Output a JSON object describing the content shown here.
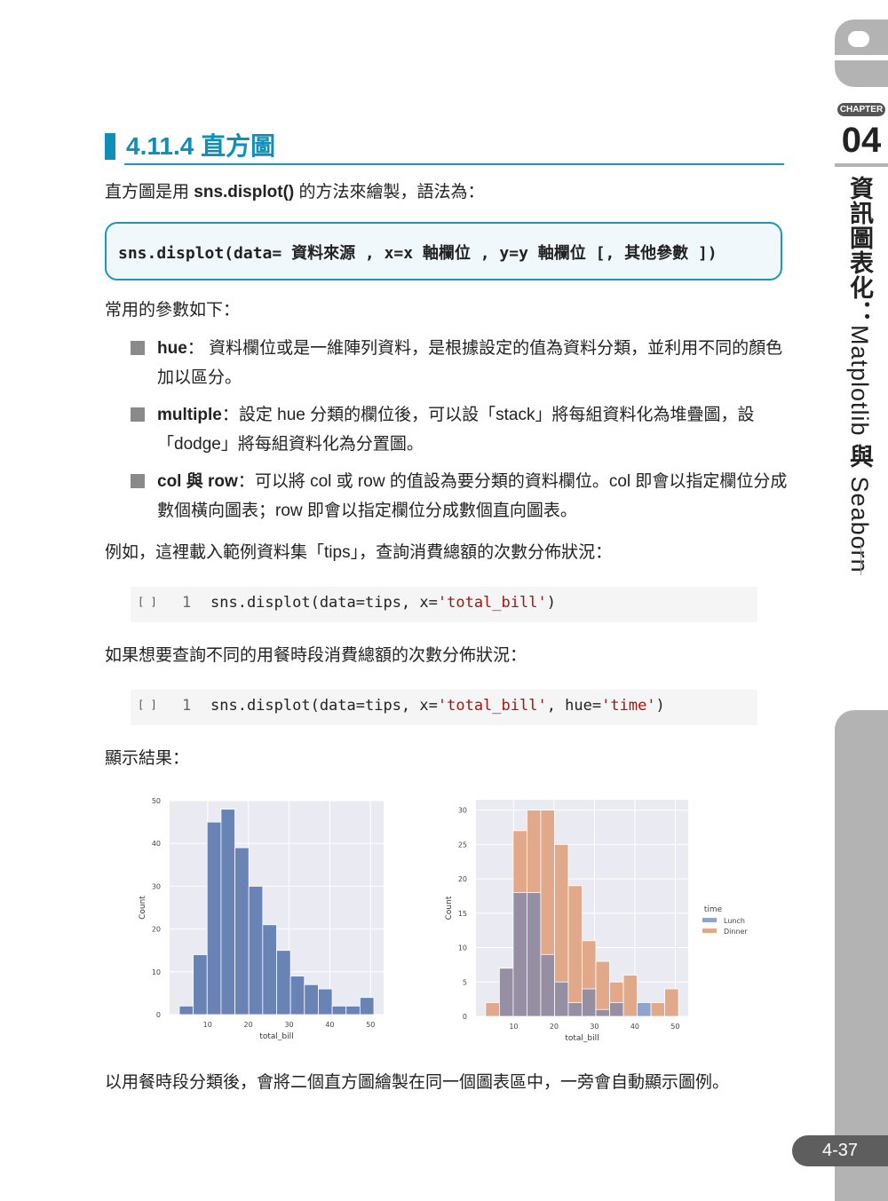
{
  "sidebar": {
    "chapter_badge": "CHAPTER",
    "chapter_number": "04",
    "chapter_title_cjk1": "資訊圖表化：",
    "chapter_title_latin1": "Matplotlib",
    "chapter_title_cjk2": " 與 ",
    "chapter_title_latin2": "Seaborn",
    "page_number": "4-37"
  },
  "section": {
    "title": "4.11.4  直方圖"
  },
  "intro": {
    "prefix": "直方圖是用 ",
    "method": "sns.displot()",
    "suffix": " 的方法來繪製，語法為："
  },
  "syntax": "sns.displot(data= 資料來源 , x=x 軸欄位 , y=y 軸欄位 [, 其他參數 ])",
  "params_intro": "常用的參數如下：",
  "params": [
    {
      "name": "hue",
      "sep": "： ",
      "desc": "資料欄位或是一維陣列資料，是根據設定的值為資料分類，並利用不同的顏色加以區分。"
    },
    {
      "name": "multiple",
      "sep": "：",
      "desc": "設定 hue 分類的欄位後，可以設「stack」將每組資料化為堆疊圖，設「dodge」將每組資料化為分置圖。"
    },
    {
      "name": "col 與 row",
      "sep": "：",
      "desc": "可以將 col 或 row 的值設為要分類的資料欄位。col 即會以指定欄位分成數個橫向圖表；row 即會以指定欄位分成數個直向圖表。"
    }
  ],
  "example1_text": "例如，這裡載入範例資料集「tips」，查詢消費總額的次數分佈狀況：",
  "code1": {
    "bracket": "[ ]",
    "line": "1",
    "pre": "sns.displot(data=tips, x=",
    "str1": "'total_bill'",
    "post": ")"
  },
  "example2_text": "如果想要查詢不同的用餐時段消費總額的次數分佈狀況：",
  "code2": {
    "bracket": "[ ]",
    "line": "1",
    "pre": "sns.displot(data=tips, x=",
    "str1": "'total_bill'",
    "mid": ", hue=",
    "str2": "'time'",
    "post": ")"
  },
  "result_label": "顯示結果：",
  "conclusion": "以用餐時段分類後，會將二個直方圖繪製在同一個圖表區中，一旁會自動顯示圖例。",
  "colors": {
    "accent": "#0f8fb8",
    "hist_blue": "#6a83b5",
    "lunch": "#8fa4cc",
    "dinner": "#e2a88a",
    "overlap": "#968ea2",
    "plot_bg": "#eaeaf2"
  },
  "chart_data": [
    {
      "type": "bar",
      "title": "",
      "xlabel": "total_bill",
      "ylabel": "Count",
      "xlim": [
        0.68,
        53.2
      ],
      "ylim": [
        0,
        50
      ],
      "xticks": [
        10,
        20,
        30,
        40,
        50
      ],
      "yticks": [
        0,
        10,
        20,
        30,
        40,
        50
      ],
      "grid": true,
      "bin_edges": [
        3.07,
        6.48,
        9.89,
        13.3,
        16.71,
        20.12,
        23.53,
        26.94,
        30.35,
        33.76,
        37.17,
        40.58,
        43.99,
        47.4,
        50.81
      ],
      "values": [
        2,
        14,
        45,
        48,
        39,
        30,
        21,
        15,
        9,
        7,
        6,
        2,
        2,
        4
      ]
    },
    {
      "type": "bar",
      "title": "",
      "xlabel": "total_bill",
      "ylabel": "Count",
      "xlim": [
        0.68,
        53.2
      ],
      "ylim": [
        0,
        31.5
      ],
      "xticks": [
        10,
        20,
        30,
        40,
        50
      ],
      "yticks": [
        0,
        5,
        10,
        15,
        20,
        25,
        30
      ],
      "grid": true,
      "legend": {
        "title": "time",
        "position": "right"
      },
      "bin_edges": [
        3.07,
        6.48,
        9.89,
        13.3,
        16.71,
        20.12,
        23.53,
        26.94,
        30.35,
        33.76,
        37.17,
        40.58,
        43.99,
        47.4,
        50.81
      ],
      "series": [
        {
          "name": "Lunch",
          "values": [
            0,
            7,
            18,
            18,
            9,
            5,
            2,
            4,
            1,
            2,
            0,
            2,
            0,
            0
          ]
        },
        {
          "name": "Dinner",
          "values": [
            2,
            7,
            27,
            30,
            30,
            25,
            19,
            11,
            8,
            5,
            6,
            0,
            2,
            4
          ]
        }
      ]
    }
  ]
}
